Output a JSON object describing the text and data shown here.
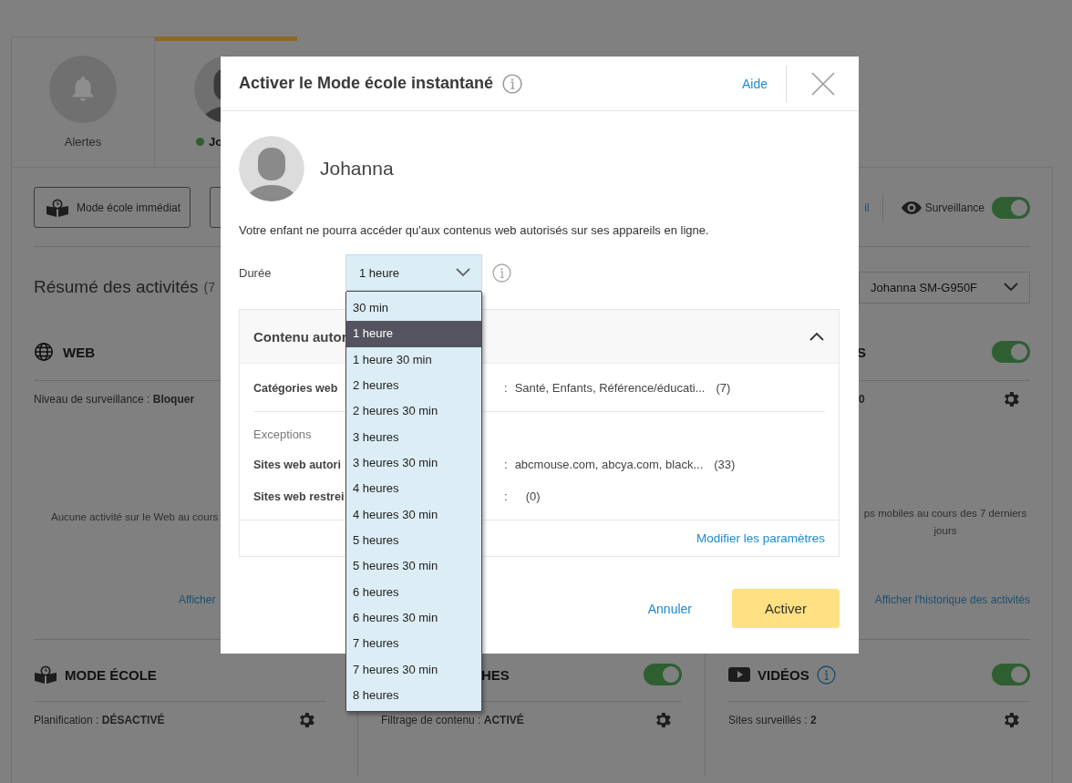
{
  "background": {
    "tabs": [
      {
        "kind": "alerts",
        "label": "Alertes",
        "selected": false
      },
      {
        "kind": "child",
        "label": "Jo",
        "selected": true,
        "online": true
      }
    ],
    "toolbar": {
      "school_button": "Mode école immédiat",
      "link": "il",
      "monitoring": {
        "label": "Surveillance",
        "on": true
      }
    },
    "summary": {
      "title": "Résumé des activités",
      "count": "(7",
      "device": "Johanna SM-G950F"
    },
    "sections": [
      {
        "kind": "web",
        "title": "WEB",
        "detail_label": "Niveau de surveillance :",
        "detail_value": "Bloquer",
        "empty_text": "Aucune activité sur le Web au cours",
        "link": "Afficher"
      },
      {
        "kind": "apps",
        "title": "S",
        "on": true,
        "detail_value": "0",
        "empty_text": "ps mobiles au cours des 7 derniers jours",
        "link": "Afficher l'historique des activités"
      }
    ],
    "cards": [
      {
        "kind": "school",
        "title": "MODE ÉCOLE",
        "label": "Planification :",
        "value": "DÉSACTIVÉ"
      },
      {
        "kind": "search",
        "title": "HES",
        "on": true,
        "label": "Filtrage de contenu :",
        "value": "ACTIVÉ"
      },
      {
        "kind": "video",
        "title": "VIDÉOS",
        "on": true,
        "label": "Sites surveillés :",
        "value": "2"
      }
    ]
  },
  "dialog": {
    "title": "Activer le Mode école instantané",
    "help": "Aide",
    "child": "Johanna",
    "description": "Votre enfant ne pourra accéder qu'aux contenus web autorisés sur ses appareils en ligne.",
    "duration": {
      "label": "Durée",
      "value": "1 heure",
      "options": [
        {
          "label": "30 min",
          "selected": false
        },
        {
          "label": "1 heure",
          "selected": true
        },
        {
          "label": "1 heure 30 min",
          "selected": false
        },
        {
          "label": "2 heures",
          "selected": false
        },
        {
          "label": "2 heures 30 min",
          "selected": false
        },
        {
          "label": "3 heures",
          "selected": false
        },
        {
          "label": "3 heures 30 min",
          "selected": false
        },
        {
          "label": "4 heures",
          "selected": false
        },
        {
          "label": "4 heures 30 min",
          "selected": false
        },
        {
          "label": "5 heures",
          "selected": false
        },
        {
          "label": "5 heures 30 min",
          "selected": false
        },
        {
          "label": "6 heures",
          "selected": false
        },
        {
          "label": "6 heures 30 min",
          "selected": false
        },
        {
          "label": "7 heures",
          "selected": false
        },
        {
          "label": "7 heures 30 min",
          "selected": false
        },
        {
          "label": "8 heures",
          "selected": false
        }
      ]
    },
    "content_panel": {
      "title": "Contenu autor",
      "expanded": true,
      "categories": {
        "label": "Catégories web",
        "separator": ":",
        "value": "Santé, Enfants, Référence/éducati...",
        "count": "(7)"
      },
      "exceptions_title": "Exceptions",
      "exceptions": [
        {
          "label": "Sites web autori",
          "separator": ":",
          "value": "abcmouse.com, abcya.com, black...",
          "count": "(33)"
        },
        {
          "label": "Sites web restrei",
          "separator": ":",
          "count": "(0)"
        }
      ],
      "link": "Modifier les paramètres"
    },
    "cancel": "Annuler",
    "confirm": "Activer"
  }
}
